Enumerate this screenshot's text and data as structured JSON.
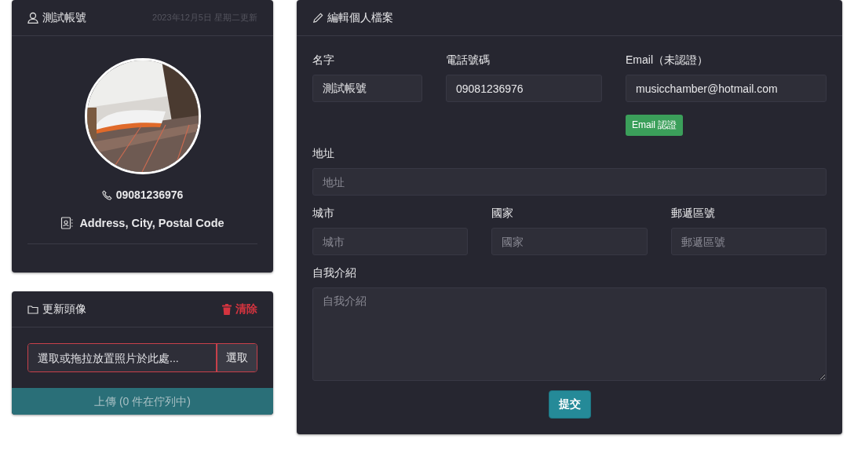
{
  "profile_card": {
    "title": "測試帳號",
    "updated": "2023年12月5日 星期二更新",
    "phone": "09081236976",
    "address": "Address, City, Postal Code"
  },
  "avatar_card": {
    "title": "更新頭像",
    "clear_label": "清除",
    "file_field": {
      "placeholder": "選取或拖拉放置照片於此處...",
      "invalid": true
    },
    "browse_button": "選取",
    "upload_status": "上傳 (0 件在佇列中)"
  },
  "edit_card": {
    "title": "編輯個人檔案",
    "rows": [
      [
        {
          "label": "名字",
          "value": "測試帳號"
        },
        {
          "label": "電話號碼",
          "value": "09081236976"
        },
        {
          "label": "Email（未認證）",
          "value": "musicchamber@hotmail.com",
          "action": "Email 認證"
        }
      ],
      [
        {
          "label": "地址",
          "placeholder": "地址"
        }
      ],
      [
        {
          "label": "城市",
          "placeholder": "城市"
        },
        {
          "label": "國家",
          "placeholder": "國家"
        },
        {
          "label": "郵遞區號",
          "placeholder": "郵遞區號"
        }
      ]
    ],
    "bio": {
      "label": "自我介紹",
      "placeholder": "自我介紹"
    },
    "submit": "提交"
  }
}
